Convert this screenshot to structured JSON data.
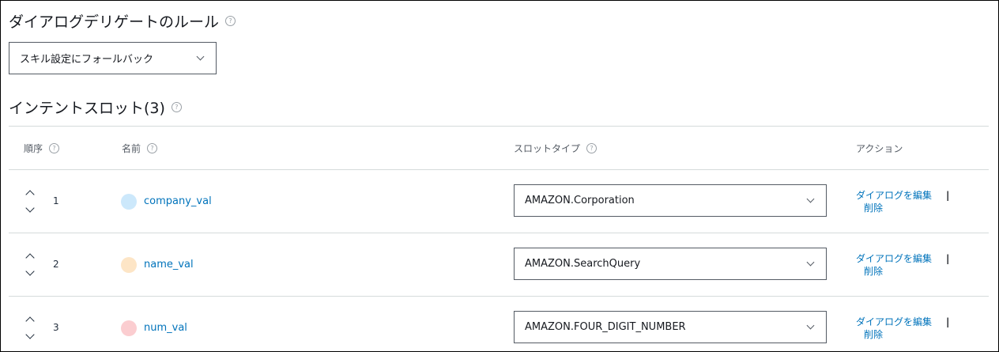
{
  "dialog_delegate": {
    "title": "ダイアログデリゲートのルール",
    "selected": "スキル設定にフォールバック"
  },
  "intent_slots": {
    "title": "インテントスロット(3)",
    "columns": {
      "order": "順序",
      "name": "名前",
      "slot_type": "スロットタイプ",
      "actions": "アクション"
    },
    "rows": [
      {
        "order": "1",
        "name": "company_val",
        "color": "#cce8fb",
        "slot_type": "AMAZON.Corporation",
        "edit": "ダイアログを編集",
        "sep": "|",
        "delete": "削除"
      },
      {
        "order": "2",
        "name": "name_val",
        "color": "#fde5c6",
        "slot_type": "AMAZON.SearchQuery",
        "edit": "ダイアログを編集",
        "sep": "|",
        "delete": "削除"
      },
      {
        "order": "3",
        "name": "num_val",
        "color": "#fbcdd0",
        "slot_type": "AMAZON.FOUR_DIGIT_NUMBER",
        "edit": "ダイアログを編集",
        "sep": "|",
        "delete": "削除"
      }
    ]
  },
  "help_glyph": "?",
  "icons": [
    "help-icon",
    "chevron-down-icon",
    "arrow-up-icon",
    "arrow-down-icon"
  ]
}
